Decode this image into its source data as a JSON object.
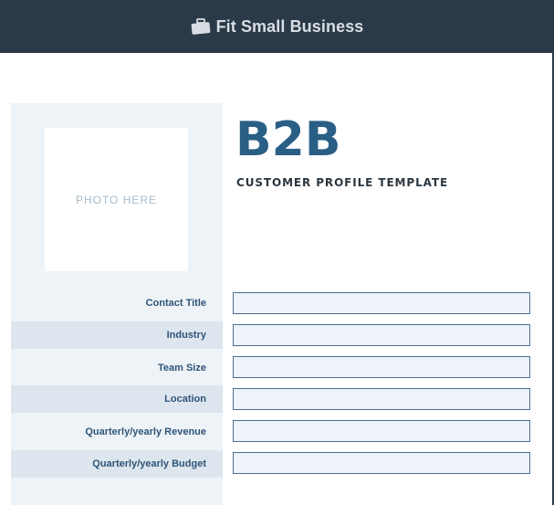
{
  "header": {
    "brand_name": "Fit Small Business",
    "brand_icon": "briefcase-icon"
  },
  "photo": {
    "placeholder": "PHOTO HERE"
  },
  "title": "B2B",
  "subtitle": "CUSTOMER PROFILE TEMPLATE",
  "fields": [
    {
      "label": "Contact Title",
      "value": ""
    },
    {
      "label": "Industry",
      "value": ""
    },
    {
      "label": "Team Size",
      "value": ""
    },
    {
      "label": "Location",
      "value": ""
    },
    {
      "label": "Quarterly/yearly Revenue",
      "value": ""
    },
    {
      "label": "Quarterly/yearly Budget",
      "value": ""
    }
  ],
  "colors": {
    "header_bg": "#2b3a48",
    "accent_blue": "#2a5f85",
    "label_blue": "#2f5477",
    "sidebar_bg": "#eef3f7",
    "band_bg": "#dde6ee",
    "input_bg": "#eef2fb"
  }
}
